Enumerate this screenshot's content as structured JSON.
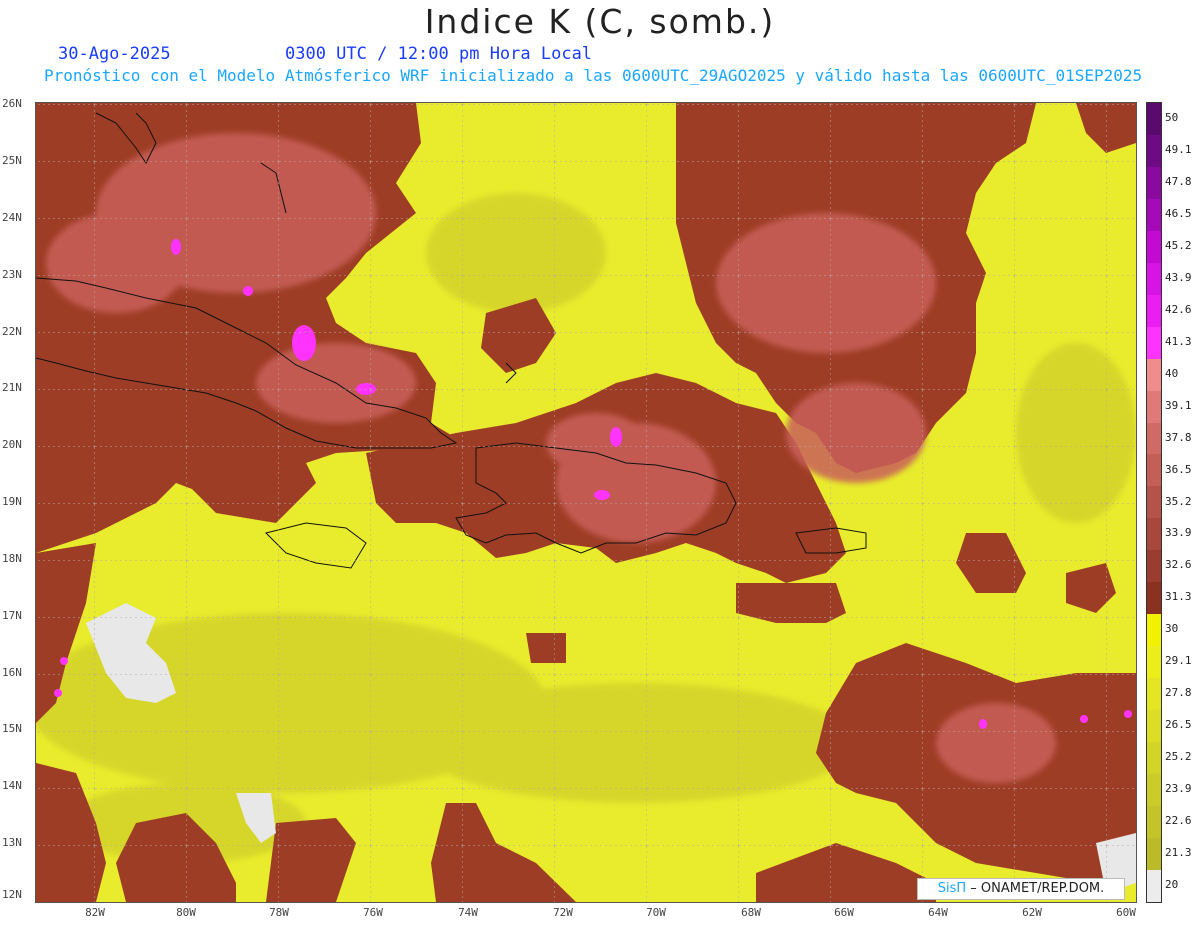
{
  "header": {
    "title": "Indice K (C, somb.)",
    "date": "30-Ago-2025",
    "time": "0300 UTC / 12:00 pm Hora Local",
    "subtitle": "Pronóstico con el Modelo Atmósferico WRF inicializado a las 0600UTC_29AGO2025 y válido hasta las  0600UTC_01SEP2025"
  },
  "map": {
    "lat_labels": [
      "26N",
      "25N",
      "24N",
      "23N",
      "22N",
      "21N",
      "20N",
      "19N",
      "18N",
      "17N",
      "16N",
      "15N",
      "14N",
      "13N",
      "12N"
    ],
    "lon_labels": [
      "82W",
      "80W",
      "78W",
      "76W",
      "74W",
      "72W",
      "70W",
      "68W",
      "66W",
      "64W",
      "62W",
      "60W"
    ],
    "field_colors": {
      "low": "#e8ec2c",
      "mid": "#c9c52a",
      "high": "#9e3d26",
      "higher": "#c9605a",
      "peak": "#ff33ff",
      "missing": "#e8e8e8"
    }
  },
  "legend": {
    "labels": [
      "50",
      "49.1",
      "47.8",
      "46.5",
      "45.2",
      "43.9",
      "42.6",
      "41.3",
      "40",
      "39.1",
      "37.8",
      "36.5",
      "35.2",
      "33.9",
      "32.6",
      "31.3",
      "30",
      "29.1",
      "27.8",
      "26.5",
      "25.2",
      "23.9",
      "22.6",
      "21.3",
      "20"
    ],
    "colors": [
      "#5a0a6e",
      "#6e0a85",
      "#8a0aa0",
      "#a40ab8",
      "#c20ad2",
      "#d714e6",
      "#ea1ef2",
      "#ff33ff",
      "#f08c8c",
      "#e07a78",
      "#d06a66",
      "#c45f58",
      "#b5524a",
      "#a8473c",
      "#9a3c30",
      "#8a3120",
      "#f2f200",
      "#ecee1a",
      "#e4e624",
      "#dcdd26",
      "#d3d428",
      "#cbcc2a",
      "#c3c42a",
      "#bbbb2a",
      "#ececec"
    ]
  },
  "credit": {
    "brand": "SisΠ",
    "org": " – ONAMET/REP.DOM."
  }
}
